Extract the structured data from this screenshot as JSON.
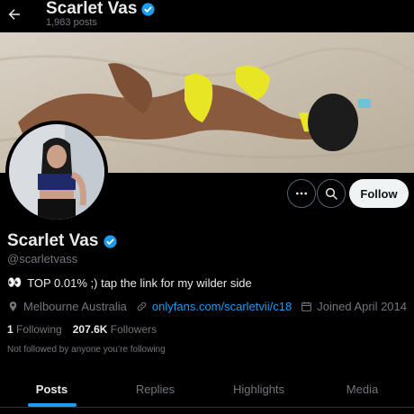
{
  "header": {
    "name": "Scarlet Vas",
    "post_count": "1,983 posts",
    "back_icon": "arrow-left-icon",
    "verified_icon": "verified-badge-icon"
  },
  "banner": {
    "icon": "banner-image"
  },
  "profile": {
    "name": "Scarlet Vas",
    "handle": "@scarletvass",
    "bio_emoji": "👀",
    "bio": "TOP 0.01% ;) tap the link for my wilder side",
    "location": "Melbourne Australia",
    "website": "onlyfans.com/scarletvii/c18",
    "joined": "Joined April 2014",
    "following_count": "1",
    "following_label": "Following",
    "followers_count": "207.6K",
    "followers_label": "Followers",
    "not_followed": "Not followed by anyone you’re following"
  },
  "actions": {
    "more_icon": "more-icon",
    "search_icon": "search-icon",
    "follow_label": "Follow"
  },
  "tabs": [
    {
      "label": "Posts"
    },
    {
      "label": "Replies"
    },
    {
      "label": "Highlights"
    },
    {
      "label": "Media"
    }
  ],
  "colors": {
    "background": "#000000",
    "accent": "#1d9bf0",
    "text": "#e7e9ea",
    "muted": "#71767b",
    "follow_bg": "#eff3f4"
  }
}
